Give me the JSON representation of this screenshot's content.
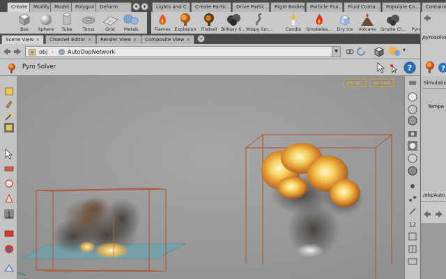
{
  "shelf": {
    "tabs": [
      "Create",
      "Modify",
      "Model",
      "Polygon",
      "Deform"
    ],
    "tabs_right": [
      "Lights and C...",
      "Create Partic...",
      "Drive Partic...",
      "Rigid Bodies",
      "Particle Flui...",
      "Fluid Conta...",
      "Populate Co...",
      "Containe"
    ],
    "tools_left": [
      {
        "icon": "box-icon",
        "label": "Box"
      },
      {
        "icon": "sphere-icon",
        "label": "Sphere"
      },
      {
        "icon": "tube-icon",
        "label": "Tube"
      },
      {
        "icon": "torus-icon",
        "label": "Torus"
      },
      {
        "icon": "grid-icon",
        "label": "Grid"
      },
      {
        "icon": "metaball-icon",
        "label": "Metab"
      }
    ],
    "tools_right": [
      {
        "icon": "flames-icon",
        "label": "Flames"
      },
      {
        "icon": "explosion-icon",
        "label": "Explosion"
      },
      {
        "icon": "fireball-icon",
        "label": "Fireball"
      },
      {
        "icon": "billowy-smoke-icon",
        "label": "Billowy S..."
      },
      {
        "icon": "wispy-smoke-icon",
        "label": "Wispy Sm..."
      },
      {
        "icon": "candle-icon",
        "label": "Candle"
      },
      {
        "icon": "smokeless-icon",
        "label": "Smokeles..."
      },
      {
        "icon": "dry-ice-icon",
        "label": "Dry Ice"
      },
      {
        "icon": "volcano-icon",
        "label": "Volcano"
      },
      {
        "icon": "smoke-cluster-icon",
        "label": "Smoke Cl..."
      },
      {
        "icon": "pyro-cluster-icon",
        "label": "Pyro Clust..."
      }
    ]
  },
  "panes": {
    "tabs": [
      "Scene View",
      "Channel Editor",
      "Render View",
      "Composite View"
    ],
    "close_glyph": "×",
    "add_glyph": "+"
  },
  "path": {
    "root": "obj",
    "node": "AutoDopNetwork"
  },
  "viewer": {
    "title": "Pyro Solver",
    "camera": "persp1",
    "cam_menu": "no cam"
  },
  "params": {
    "node_name": "pyrosolver",
    "section": "Simulatio",
    "field": "Tempe",
    "network_path": "/obj/Auto"
  },
  "colors": {
    "bbox": "#b0522b",
    "ground_plane": "#5ea8b8",
    "cam_label": "#e6c63a"
  }
}
